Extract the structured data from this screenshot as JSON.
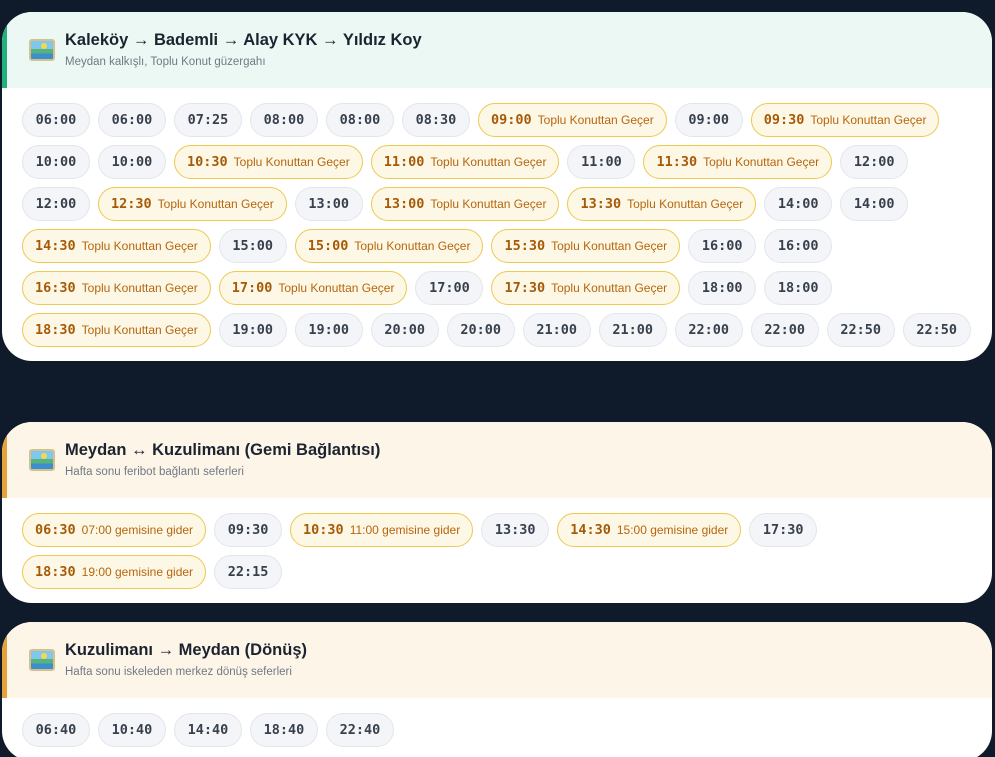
{
  "routes": [
    {
      "title": "Kaleköy → Bademli → Alay KYK → Yıldız Koy",
      "subtitle": "Meydan kalkışlı, Toplu Konut güzergahı",
      "accent": "#22b07d",
      "times": [
        {
          "time": "06:00",
          "note": ""
        },
        {
          "time": "06:00",
          "note": ""
        },
        {
          "time": "07:25",
          "note": ""
        },
        {
          "time": "08:00",
          "note": ""
        },
        {
          "time": "08:00",
          "note": ""
        },
        {
          "time": "08:30",
          "note": ""
        },
        {
          "time": "09:00",
          "note": "Toplu Konuttan Geçer"
        },
        {
          "time": "09:00",
          "note": ""
        },
        {
          "time": "09:30",
          "note": "Toplu Konuttan Geçer"
        },
        {
          "time": "10:00",
          "note": ""
        },
        {
          "time": "10:00",
          "note": ""
        },
        {
          "time": "10:30",
          "note": "Toplu Konuttan Geçer"
        },
        {
          "time": "11:00",
          "note": "Toplu Konuttan Geçer"
        },
        {
          "time": "11:00",
          "note": ""
        },
        {
          "time": "11:30",
          "note": "Toplu Konuttan Geçer"
        },
        {
          "time": "12:00",
          "note": ""
        },
        {
          "time": "12:00",
          "note": ""
        },
        {
          "time": "12:30",
          "note": "Toplu Konuttan Geçer"
        },
        {
          "time": "13:00",
          "note": ""
        },
        {
          "time": "13:00",
          "note": "Toplu Konuttan Geçer"
        },
        {
          "time": "13:30",
          "note": "Toplu Konuttan Geçer"
        },
        {
          "time": "14:00",
          "note": ""
        },
        {
          "time": "14:00",
          "note": ""
        },
        {
          "time": "14:30",
          "note": "Toplu Konuttan Geçer"
        },
        {
          "time": "15:00",
          "note": ""
        },
        {
          "time": "15:00",
          "note": "Toplu Konuttan Geçer"
        },
        {
          "time": "15:30",
          "note": "Toplu Konuttan Geçer"
        },
        {
          "time": "16:00",
          "note": ""
        },
        {
          "time": "16:00",
          "note": ""
        },
        {
          "time": "16:30",
          "note": "Toplu Konuttan Geçer"
        },
        {
          "time": "17:00",
          "note": "Toplu Konuttan Geçer"
        },
        {
          "time": "17:00",
          "note": ""
        },
        {
          "time": "17:30",
          "note": "Toplu Konuttan Geçer"
        },
        {
          "time": "18:00",
          "note": ""
        },
        {
          "time": "18:00",
          "note": ""
        },
        {
          "time": "18:30",
          "note": "Toplu Konuttan Geçer"
        },
        {
          "time": "19:00",
          "note": ""
        },
        {
          "time": "19:00",
          "note": ""
        },
        {
          "time": "20:00",
          "note": ""
        },
        {
          "time": "20:00",
          "note": ""
        },
        {
          "time": "21:00",
          "note": ""
        },
        {
          "time": "21:00",
          "note": ""
        },
        {
          "time": "22:00",
          "note": ""
        },
        {
          "time": "22:00",
          "note": ""
        },
        {
          "time": "22:50",
          "note": ""
        },
        {
          "time": "22:50",
          "note": ""
        }
      ]
    },
    {
      "title": "Meydan ↔ Kuzulimanı (Gemi Bağlantısı)",
      "subtitle": "Hafta sonu feribot bağlantı seferleri",
      "accent": "#e6a23a",
      "times": [
        {
          "time": "06:30",
          "note": "07:00 gemisine gider"
        },
        {
          "time": "09:30",
          "note": ""
        },
        {
          "time": "10:30",
          "note": "11:00 gemisine gider"
        },
        {
          "time": "13:30",
          "note": ""
        },
        {
          "time": "14:30",
          "note": "15:00 gemisine gider"
        },
        {
          "time": "17:30",
          "note": ""
        },
        {
          "time": "18:30",
          "note": "19:00 gemisine gider"
        },
        {
          "time": "22:15",
          "note": ""
        }
      ]
    },
    {
      "title": "Kuzulimanı → Meydan (Dönüş)",
      "subtitle": "Hafta sonu iskeleden merkez dönüş seferleri",
      "accent": "#e6a23a",
      "times": [
        {
          "time": "06:40",
          "note": ""
        },
        {
          "time": "10:40",
          "note": ""
        },
        {
          "time": "14:40",
          "note": ""
        },
        {
          "time": "18:40",
          "note": ""
        },
        {
          "time": "22:40",
          "note": ""
        }
      ]
    }
  ]
}
